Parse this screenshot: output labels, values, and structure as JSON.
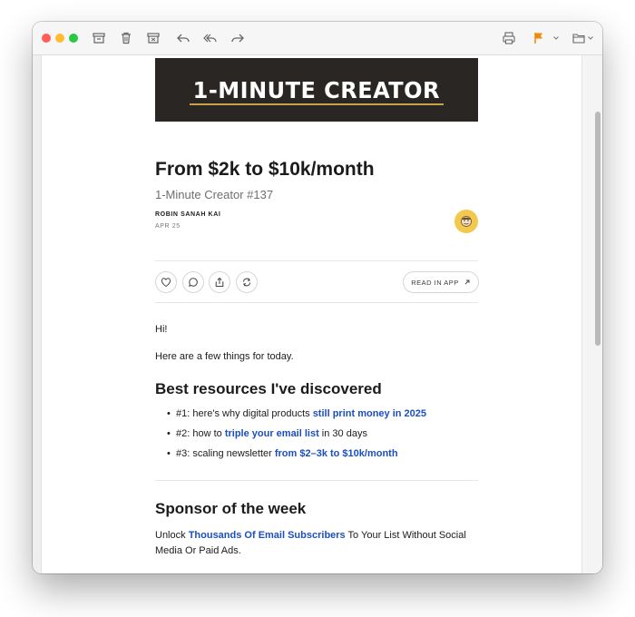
{
  "toolbar": {
    "buttons": [
      "archive-icon",
      "trash-icon",
      "junk-icon",
      "reply-icon",
      "reply-all-icon",
      "forward-icon",
      "print-icon",
      "flag-icon",
      "move-folder-icon"
    ],
    "traffic_lights": {
      "close": "#ff5f57",
      "minimize": "#febc2e",
      "zoom": "#28c840"
    },
    "flag_color": "#f0890e"
  },
  "banner": {
    "text": "1-MINUTE CREATOR"
  },
  "post": {
    "title": "From $2k to $10k/month",
    "subtitle": "1-Minute Creator #137",
    "author": "ROBIN SANAH KAI",
    "date": "APR 25",
    "actions": [
      "heart-icon",
      "comment-icon",
      "share-icon",
      "restack-icon"
    ],
    "read_in_app": "READ IN APP"
  },
  "body": {
    "greeting": "Hi!",
    "intro": "Here are a few things for today.",
    "resources_heading": "Best resources I've discovered",
    "resources": [
      {
        "prefix": "#1: here's why digital products ",
        "link": "still print money in 2025",
        "suffix": ""
      },
      {
        "prefix": "#2: how to ",
        "link": "triple your email list",
        "suffix": " in 30 days"
      },
      {
        "prefix": "#3: scaling newsletter ",
        "link": "from $2–3k to $10k/month",
        "suffix": ""
      }
    ],
    "sponsor_heading": "Sponsor of the week",
    "sponsor": {
      "prefix": "Unlock ",
      "link": "Thousands Of Email Subscribers",
      "suffix": " To Your List Without Social Media Or Paid Ads."
    }
  },
  "colors": {
    "link": "#1a4fc4",
    "avatar_bg": "#f2c94c",
    "banner_bg": "#2a2624"
  }
}
